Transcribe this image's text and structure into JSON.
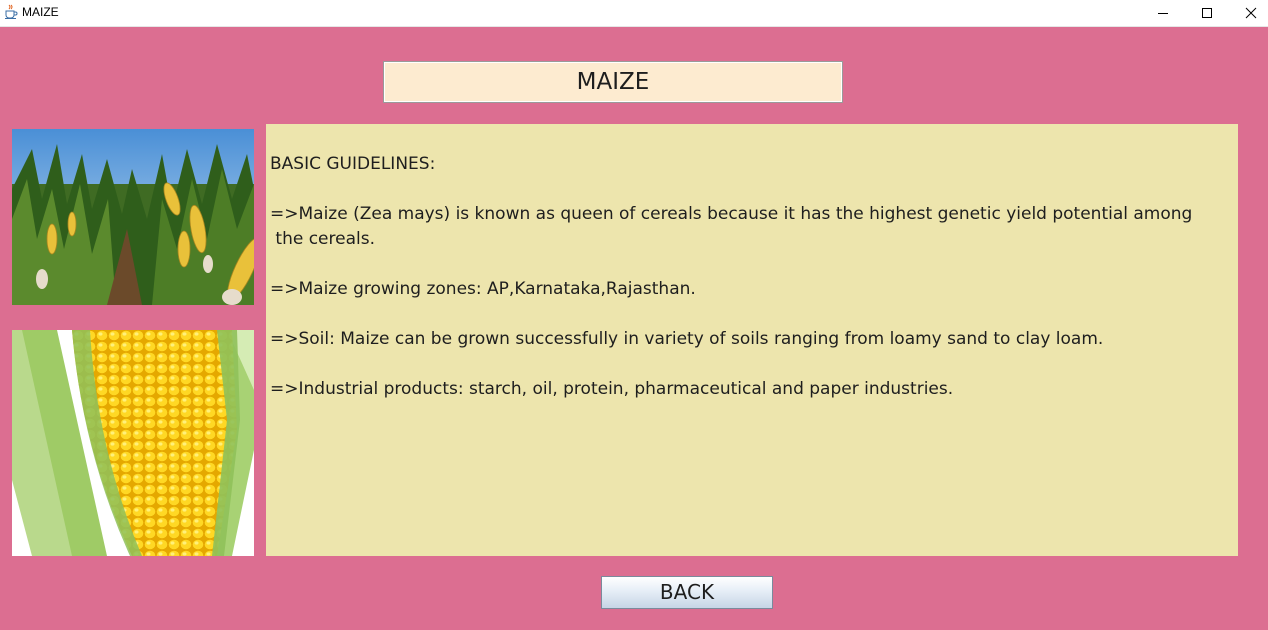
{
  "window": {
    "title": "MAIZE",
    "icon": "java-coffee-icon",
    "controls": [
      "minimize-icon",
      "maximize-icon",
      "close-icon"
    ]
  },
  "heading": "MAIZE",
  "images": [
    {
      "name": "maize-field-photo"
    },
    {
      "name": "corn-cob-photo"
    }
  ],
  "guidelines": {
    "title": "BASIC GUIDELINES:",
    "items": [
      "=>Maize (Zea mays) is known as queen of cereals because it has the highest genetic yield potential among\n the cereals.",
      "=>Maize growing zones: AP,Karnataka,Rajasthan.",
      "=>Soil: Maize can be grown successfully in variety of soils ranging from loamy sand to clay loam.",
      "=>Industrial products: starch, oil, protein, pharmaceutical and paper industries."
    ]
  },
  "back_button": "BACK",
  "colors": {
    "background": "#dc6e91",
    "heading_bg": "#fdebd0",
    "panel_bg": "#ede5ad"
  }
}
